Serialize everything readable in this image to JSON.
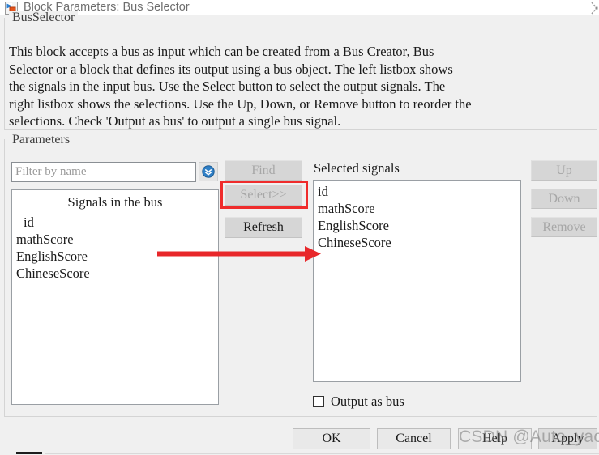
{
  "window": {
    "title": "Block Parameters: Bus Selector",
    "icon": "simulink-block-icon",
    "close_icon": "close-icon"
  },
  "description_group": {
    "legend": "BusSelector",
    "text": "This block accepts a bus as input which can be created from a Bus Creator, Bus\nSelector or a block that defines its output using a bus object. The left listbox shows\nthe signals in the input bus. Use the Select button to select the output signals. The\nright listbox shows the selections. Use the Up, Down, or Remove button to reorder the\nselections. Check 'Output as bus' to output a single bus signal."
  },
  "parameters_group": {
    "legend": "Parameters",
    "filter": {
      "value": "",
      "placeholder": "Filter by name",
      "dropdown_icon": "chevron-double-down-icon"
    },
    "buttons": {
      "find": "Find",
      "select": "Select>>",
      "refresh": "Refresh",
      "up": "Up",
      "down": "Down",
      "remove": "Remove"
    },
    "left_list": {
      "header": "Signals in the bus",
      "items": [
        "id",
        "mathScore",
        "EnglishScore",
        "ChineseScore"
      ]
    },
    "right_list": {
      "label": "Selected signals",
      "items": [
        "id",
        "mathScore",
        "EnglishScore",
        "ChineseScore"
      ]
    },
    "output_as_bus": {
      "label": "Output as bus",
      "checked": false
    }
  },
  "footer": {
    "ok": "OK",
    "cancel": "Cancel",
    "help": "Help",
    "apply": "Apply"
  },
  "annotations": {
    "highlight_color": "#ef2c2c",
    "arrow_color": "#e8272a",
    "watermark": "CSDN @Auto_yaoyaoy"
  }
}
